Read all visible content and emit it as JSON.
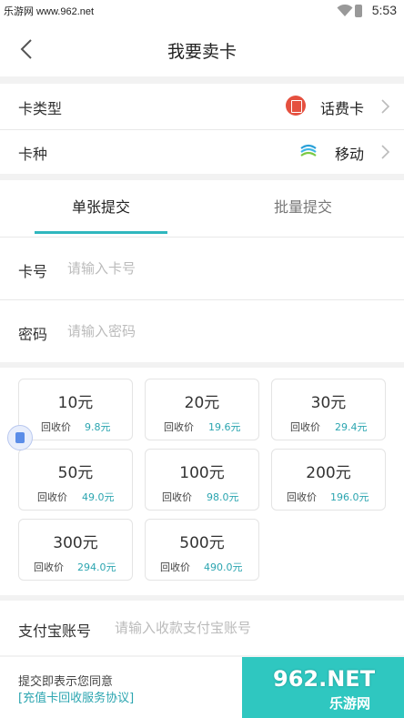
{
  "status_bar": {
    "watermark": "乐游网 www.962.net",
    "time": "5:53"
  },
  "header": {
    "title": "我要卖卡"
  },
  "card_type": {
    "label": "卡类型",
    "value": "话费卡"
  },
  "card_kind": {
    "label": "卡种",
    "value": "移动"
  },
  "tabs": [
    {
      "label": "单张提交",
      "active": true
    },
    {
      "label": "批量提交",
      "active": false
    }
  ],
  "card_number": {
    "label": "卡号",
    "placeholder": "请输入卡号"
  },
  "password": {
    "label": "密码",
    "placeholder": "请输入密码"
  },
  "denominations": [
    {
      "amount": "10元",
      "recycle_label": "回收价",
      "recycle_price": "9.8元"
    },
    {
      "amount": "20元",
      "recycle_label": "回收价",
      "recycle_price": "19.6元"
    },
    {
      "amount": "30元",
      "recycle_label": "回收价",
      "recycle_price": "29.4元"
    },
    {
      "amount": "50元",
      "recycle_label": "回收价",
      "recycle_price": "49.0元"
    },
    {
      "amount": "100元",
      "recycle_label": "回收价",
      "recycle_price": "98.0元"
    },
    {
      "amount": "200元",
      "recycle_label": "回收价",
      "recycle_price": "196.0元"
    },
    {
      "amount": "300元",
      "recycle_label": "回收价",
      "recycle_price": "294.0元"
    },
    {
      "amount": "500元",
      "recycle_label": "回收价",
      "recycle_price": "490.0元"
    }
  ],
  "alipay": {
    "label": "支付宝账号",
    "placeholder": "请输入收款支付宝账号"
  },
  "footer": {
    "agree_text": "提交即表示您同意",
    "agreement_link": "[充值卡回收服务协议]"
  },
  "watermark_logo": {
    "big": "962.NET",
    "small": "乐游网"
  },
  "colors": {
    "accent": "#2fb7be",
    "price": "#2ba5b0",
    "submit_bg": "#2fc7c0",
    "card_type_icon": "#e5503f"
  }
}
